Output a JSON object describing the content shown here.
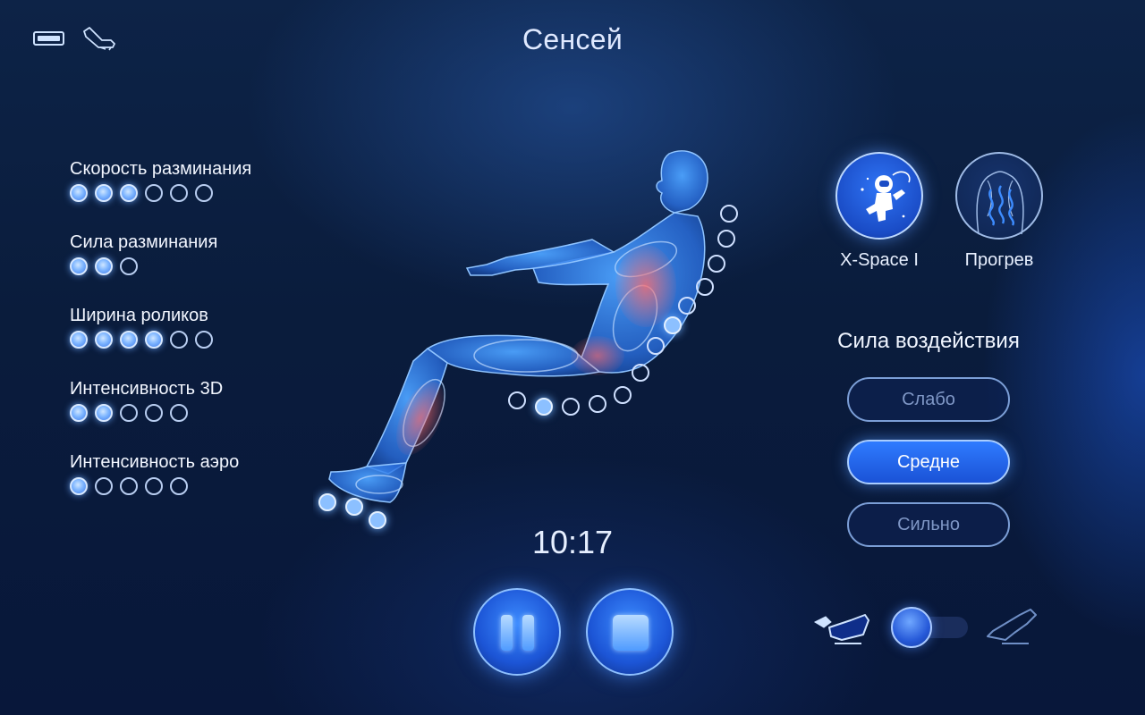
{
  "header": {
    "title": "Сенсей",
    "battery_icon": "battery-icon",
    "chair_icon": "recline-chair-icon"
  },
  "settings": [
    {
      "label": "Скорость разминания",
      "level": 3,
      "max": 6
    },
    {
      "label": "Сила разминания",
      "level": 2,
      "max": 3
    },
    {
      "label": "Ширина роликов",
      "level": 4,
      "max": 6
    },
    {
      "label": "Интенсивность 3D",
      "level": 2,
      "max": 5
    },
    {
      "label": "Интенсивность аэро",
      "level": 1,
      "max": 5
    }
  ],
  "body": {
    "back_rollers_active": [
      5
    ],
    "seat_rollers_active": [
      1
    ],
    "foot_rollers_active": [
      0,
      1,
      2
    ]
  },
  "timer": "10:17",
  "controls": {
    "pause_icon": "pause-icon",
    "stop_icon": "stop-icon"
  },
  "programs": [
    {
      "label": "X-Space I",
      "icon": "astronaut-icon",
      "selected": true
    },
    {
      "label": "Прогрев",
      "icon": "back-heat-icon",
      "selected": false
    }
  ],
  "intensity": {
    "title": "Сила воздействия",
    "options": [
      "Слабо",
      "Средне",
      "Сильно"
    ],
    "selected": "Средне"
  },
  "recline_toggle": {
    "left_icon": "upright-chair-icon",
    "right_icon": "reclined-chair-icon",
    "state": "left"
  },
  "colors": {
    "accent": "#2f7bff",
    "background": "#0a1c3c",
    "heat": "#ff6a6a"
  }
}
